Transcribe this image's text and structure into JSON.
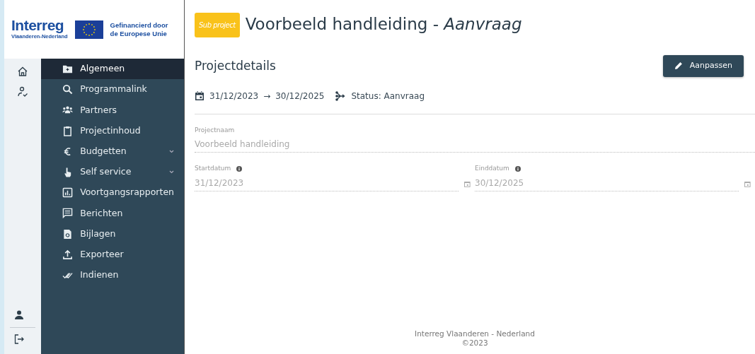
{
  "logo": {
    "name": "Interreg",
    "region": "Vlaanderen-Nederland",
    "funding": "Gefinancierd door de Europese Unie"
  },
  "rail": [
    {
      "kind": "home",
      "selected": false
    },
    {
      "kind": "user-check",
      "selected": false
    }
  ],
  "rail_bottom": [
    {
      "kind": "user"
    },
    {
      "kind": "logout"
    }
  ],
  "nav": [
    {
      "label": "Algemeen",
      "selected": true,
      "expandable": false
    },
    {
      "label": "Programmalink",
      "selected": false,
      "expandable": false
    },
    {
      "label": "Partners",
      "selected": false,
      "expandable": false
    },
    {
      "label": "Projectinhoud",
      "selected": false,
      "expandable": false
    },
    {
      "label": "Budgetten",
      "selected": false,
      "expandable": true
    },
    {
      "label": "Self service",
      "selected": false,
      "expandable": true
    },
    {
      "label": "Voortgangsrapporten",
      "selected": false,
      "expandable": false
    },
    {
      "label": "Berichten",
      "selected": false,
      "expandable": false
    },
    {
      "label": "Bijlagen",
      "selected": false,
      "expandable": false
    },
    {
      "label": "Exporteer",
      "selected": false,
      "expandable": false
    },
    {
      "label": "Indienen",
      "selected": false,
      "expandable": false
    }
  ],
  "header": {
    "badge": "Sub project",
    "title": "Voorbeeld handleiding - *Aanvraag*"
  },
  "section": {
    "title": "Projectdetails",
    "button": "Aanpassen",
    "start": "31/12/2023",
    "arrow": "→",
    "end": "30/12/2025",
    "status": "Status: Aanvraag"
  },
  "fields": [
    {
      "label": "Projectnaam",
      "value": "Voorbeeld handleiding",
      "kind": "text",
      "info": false
    },
    {
      "label": "Startdatum",
      "value": "31/12/2023",
      "kind": "date",
      "info": true
    },
    {
      "label": "Einddatum",
      "value": "30/12/2025",
      "kind": "date",
      "info": true
    }
  ],
  "footer": {
    "org": "Interreg Vlaanderen - Nederland",
    "copyright": "©2023"
  }
}
